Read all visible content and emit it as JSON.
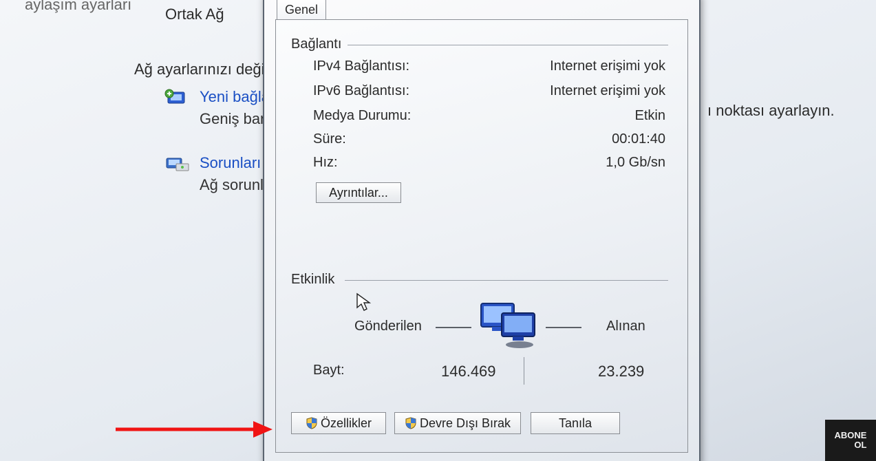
{
  "background": {
    "truncated_title": "aylaşım ayarları",
    "ortak_ag": "Ortak Ağ",
    "change_label": "Ağ ayarlarınızı değiş",
    "link1": "Yeni bağla",
    "link1_sub": "Geniş ban",
    "link2": "Sorunları g",
    "link2_sub": "Ağ sorunl",
    "right_fragment": "ı noktası ayarlayın."
  },
  "dialog": {
    "tab": "Genel",
    "connection_group": "Bağlantı",
    "rows": {
      "ipv4_label": "IPv4 Bağlantısı:",
      "ipv4_value": "Internet erişimi yok",
      "ipv6_label": "IPv6 Bağlantısı:",
      "ipv6_value": "Internet erişimi yok",
      "media_label": "Medya Durumu:",
      "media_value": "Etkin",
      "duration_label": "Süre:",
      "duration_value": "00:01:40",
      "speed_label": "Hız:",
      "speed_value": "1,0 Gb/sn"
    },
    "details_btn": "Ayrıntılar...",
    "activity_group": "Etkinlik",
    "activity": {
      "sent_label": "Gönderilen",
      "recv_label": "Alınan",
      "bytes_label": "Bayt:",
      "sent_value": "146.469",
      "recv_value": "23.239"
    },
    "buttons": {
      "properties": "Özellikler",
      "disable": "Devre Dışı Bırak",
      "diagnose": "Tanıla"
    }
  },
  "badge": "ABONE\nOL"
}
